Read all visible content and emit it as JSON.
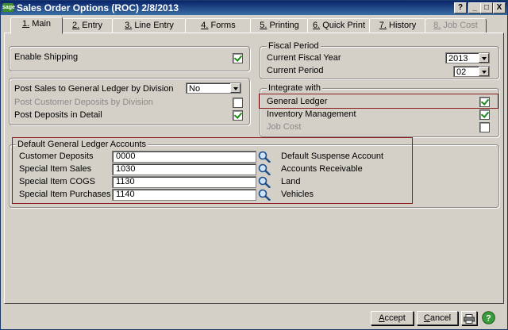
{
  "window": {
    "logo_text": "sage",
    "title": "Sales Order Options (ROC) 2/8/2013",
    "help_btn": "?",
    "minimize_btn": "_",
    "maximize_btn": "□",
    "close_btn": "X"
  },
  "tabs": [
    {
      "key": "1.",
      "label": " Main",
      "active": true,
      "disabled": false
    },
    {
      "key": "2.",
      "label": " Entry",
      "active": false,
      "disabled": false
    },
    {
      "key": "3.",
      "label": " Line Entry",
      "active": false,
      "disabled": false
    },
    {
      "key": "4.",
      "label": " Forms",
      "active": false,
      "disabled": false
    },
    {
      "key": "5.",
      "label": " Printing",
      "active": false,
      "disabled": false
    },
    {
      "key": "6.",
      "label": " Quick Print",
      "active": false,
      "disabled": false
    },
    {
      "key": "7.",
      "label": " History",
      "active": false,
      "disabled": false
    },
    {
      "key": "8.",
      "label": " Job Cost",
      "active": false,
      "disabled": true
    }
  ],
  "main": {
    "enable_shipping": {
      "label": "Enable Shipping",
      "checked": true
    },
    "post_sales_gl_by_division": {
      "label": "Post Sales to General Ledger by Division",
      "value": "No"
    },
    "post_customer_deposits_by_division": {
      "label": "Post Customer Deposits by Division",
      "checked": false
    },
    "post_deposits_in_detail": {
      "label": "Post Deposits in Detail",
      "checked": true
    },
    "fiscal_period": {
      "legend": "Fiscal Period",
      "current_year_label": "Current Fiscal Year",
      "current_year_value": "2013",
      "current_period_label": "Current Period",
      "current_period_value": "02"
    },
    "integrate_with": {
      "legend": "Integrate with",
      "general_ledger": {
        "label": "General Ledger",
        "checked": true
      },
      "inventory_management": {
        "label": "Inventory Management",
        "checked": true
      },
      "job_cost": {
        "label": "Job Cost",
        "checked": false
      }
    },
    "gl_accounts": {
      "legend": "Default General Ledger Accounts",
      "rows": [
        {
          "label": "Customer Deposits",
          "value": "0000",
          "description": "Default Suspense Account"
        },
        {
          "label": "Special Item Sales",
          "value": "1030",
          "description": "Accounts Receivable"
        },
        {
          "label": "Special Item COGS",
          "value": "1130",
          "description": "Land"
        },
        {
          "label": "Special Item Purchases",
          "value": "1140",
          "description": "Vehicles"
        }
      ]
    }
  },
  "footer": {
    "accept_key": "A",
    "accept_rest": "ccept",
    "cancel_key": "C",
    "cancel_rest": "ancel"
  },
  "colors": {
    "title_bar": "#0a246a",
    "highlight_border": "#8b1a1a",
    "check_mark": "#1a8a1a",
    "face": "#d4d0c8"
  }
}
